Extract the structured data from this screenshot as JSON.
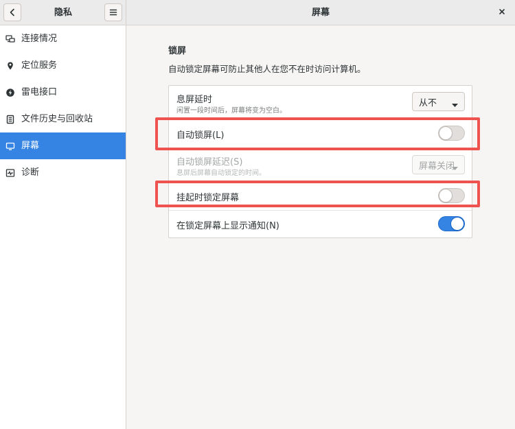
{
  "header": {
    "left_title": "隐私",
    "right_title": "屏幕",
    "back_icon": "chevron-left-icon",
    "menu_icon": "hamburger-menu-icon",
    "close_icon": "close-icon"
  },
  "sidebar": {
    "items": [
      {
        "label": "连接情况",
        "icon": "network-computer-icon",
        "active": false
      },
      {
        "label": "定位服务",
        "icon": "location-pin-icon",
        "active": false
      },
      {
        "label": "雷电接口",
        "icon": "thunderbolt-icon",
        "active": false
      },
      {
        "label": "文件历史与回收站",
        "icon": "document-history-icon",
        "active": false
      },
      {
        "label": "屏幕",
        "icon": "display-icon",
        "active": true
      },
      {
        "label": "诊断",
        "icon": "diagnostics-icon",
        "active": false
      }
    ]
  },
  "main": {
    "section_title": "锁屏",
    "section_desc": "自动锁定屏幕可防止其他人在您不在时访问计算机。",
    "rows": [
      {
        "title": "息屏延时",
        "subtitle": "闲置一段时间后，屏幕将变为空白。",
        "control": "dropdown",
        "value": "从不",
        "enabled": true
      },
      {
        "title": "自动锁屏(L)",
        "control": "switch",
        "state": "off",
        "enabled": true
      },
      {
        "title": "自动锁屏延迟(S)",
        "subtitle": "息屏后屏幕自动锁定的时间。",
        "control": "dropdown",
        "value": "屏幕关闭",
        "enabled": false
      },
      {
        "title": "挂起时锁定屏幕",
        "control": "switch",
        "state": "off",
        "enabled": true
      },
      {
        "title": "在锁定屏幕上显示通知(N)",
        "control": "switch",
        "state": "on",
        "enabled": true
      }
    ]
  },
  "colors": {
    "accent": "#3584e4",
    "highlight": "#ef5350"
  }
}
